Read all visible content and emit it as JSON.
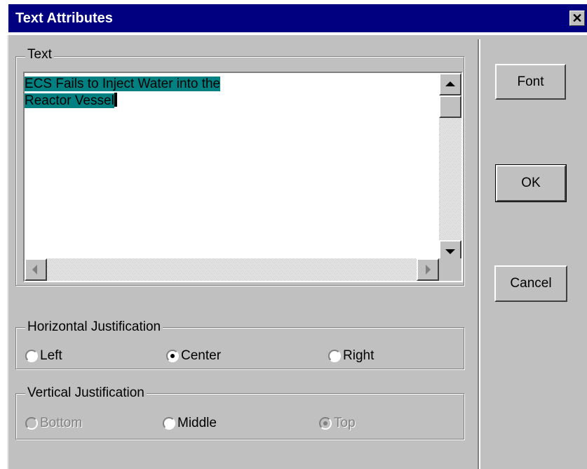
{
  "window": {
    "title": "Text Attributes",
    "close_glyph": "✕"
  },
  "text_group": {
    "legend": "Text",
    "line1": "ECS Fails to Inject Water into the",
    "line2": "Reactor Vessel",
    "highlight_color": "#008080"
  },
  "horizontal": {
    "legend": "Horizontal Justification",
    "options": [
      {
        "label": "Left",
        "selected": false,
        "enabled": true
      },
      {
        "label": "Center",
        "selected": true,
        "enabled": true
      },
      {
        "label": "Right",
        "selected": false,
        "enabled": true
      }
    ]
  },
  "vertical": {
    "legend": "Vertical Justification",
    "options": [
      {
        "label": "Bottom",
        "selected": false,
        "enabled": false
      },
      {
        "label": "Middle",
        "selected": false,
        "enabled": true
      },
      {
        "label": "Top",
        "selected": true,
        "enabled": false
      }
    ]
  },
  "buttons": {
    "font": "Font",
    "ok": "OK",
    "cancel": "Cancel"
  },
  "colors": {
    "title_bar": "#000080",
    "face": "#c0c0c0"
  }
}
